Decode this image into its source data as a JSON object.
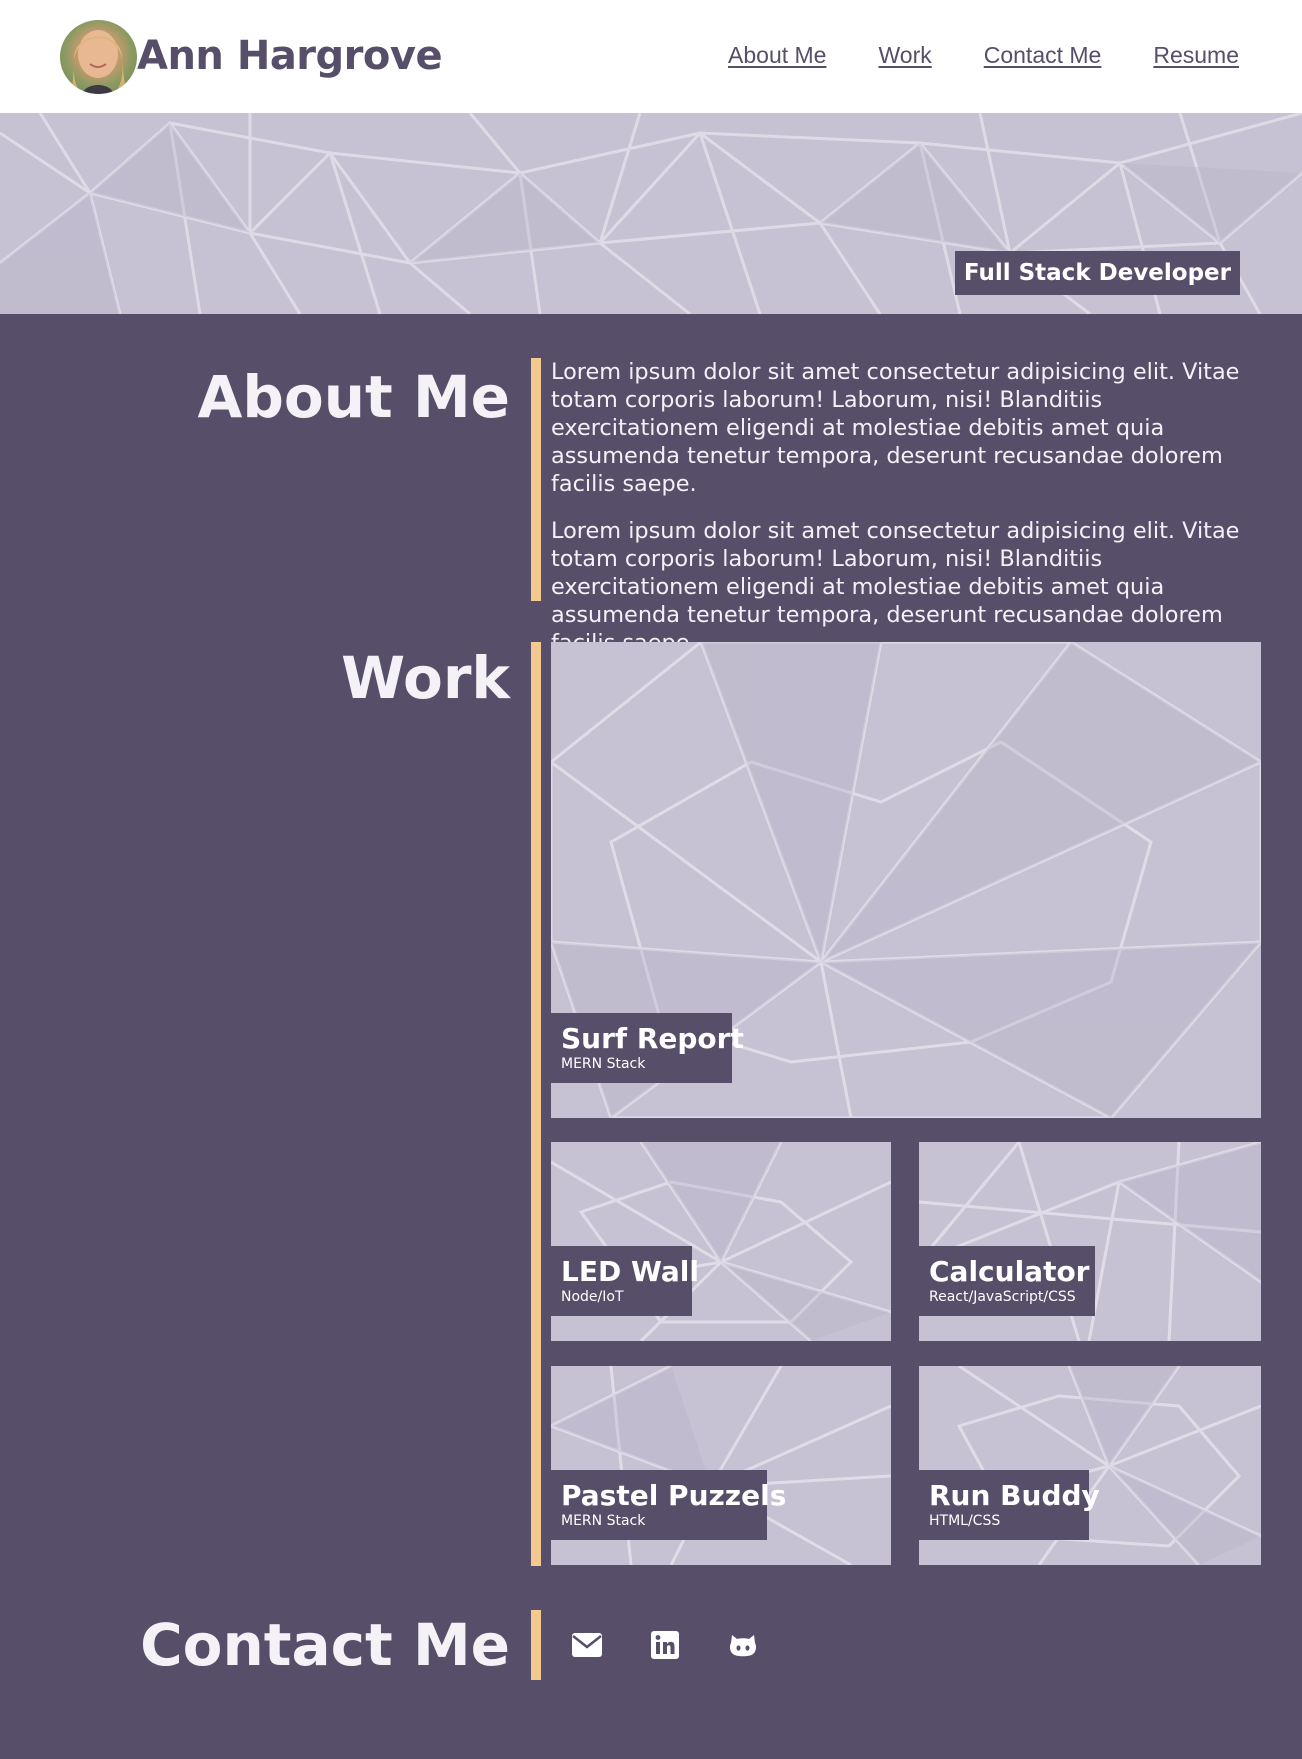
{
  "header": {
    "site_name": "Ann Hargrove",
    "nav": [
      {
        "label": "About Me"
      },
      {
        "label": "Work"
      },
      {
        "label": "Contact Me"
      },
      {
        "label": "Resume"
      }
    ]
  },
  "hero": {
    "badge": "Full Stack Developer"
  },
  "about": {
    "title": "About Me",
    "paragraphs": [
      "Lorem ipsum dolor sit amet consectetur adipisicing elit. Vitae totam corporis laborum! Laborum, nisi! Blanditiis exercitationem eligendi at molestiae debitis amet quia assumenda tenetur tempora, deserunt recusandae dolorem facilis saepe.",
      "Lorem ipsum dolor sit amet consectetur adipisicing elit. Vitae totam corporis laborum! Laborum, nisi! Blanditiis exercitationem eligendi at molestiae debitis amet quia assumenda tenetur tempora, deserunt recusandae dolorem facilis saepe."
    ]
  },
  "work": {
    "title": "Work",
    "projects": [
      {
        "title": "Surf Report",
        "stack": "MERN Stack"
      },
      {
        "title": "LED Wall",
        "stack": "Node/IoT"
      },
      {
        "title": "Calculator",
        "stack": "React/JavaScript/CSS"
      },
      {
        "title": "Pastel Puzzels",
        "stack": "MERN Stack"
      },
      {
        "title": "Run Buddy",
        "stack": "HTML/CSS"
      }
    ]
  },
  "contact": {
    "title": "Contact Me",
    "icons": [
      "envelope-icon",
      "linkedin-icon",
      "github-icon"
    ]
  },
  "colors": {
    "primary": "#574f69",
    "accent": "#f4c98f",
    "tile": "#c6c1d3",
    "header_bg": "#ffffff"
  }
}
